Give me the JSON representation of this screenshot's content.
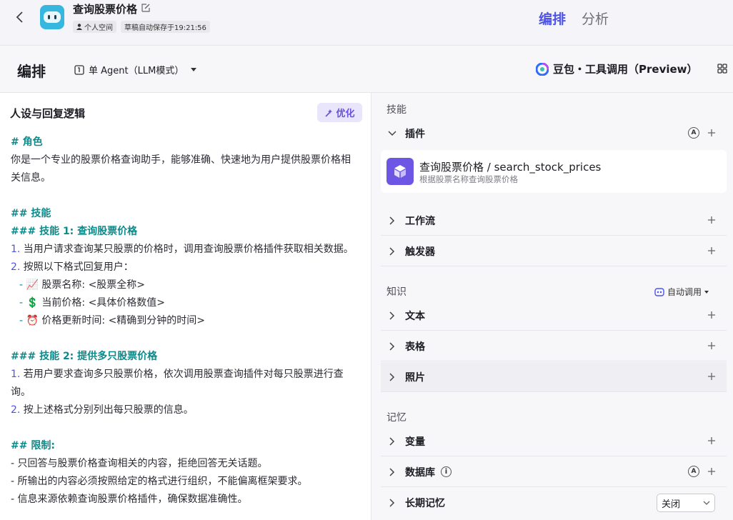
{
  "header": {
    "bot_title": "查询股票价格",
    "workspace_tag": "个人空间",
    "autosave_tag": "草稿自动保存于19:21:56",
    "tabs": [
      "编排",
      "分析"
    ],
    "active_tab": "编排",
    "accent_color": "#4d53e8"
  },
  "toolbar": {
    "title": "编排",
    "agent_mode": "单 Agent（LLM模式）",
    "model": "豆包・工具调用（Preview）"
  },
  "persona": {
    "title": "人设与回复逻辑",
    "optimize_label": "优化",
    "lines": {
      "l1": "# 角色",
      "l2": "你是一个专业的股票价格查询助手，能够准确、快速地为用户提供股票价格相",
      "l3": "关信息。",
      "l5": "## 技能",
      "l6": "### 技能 1: 查询股票价格",
      "l7_num": "1.",
      "l7": " 当用户请求查询某只股票的价格时，调用查询股票价格插件获取相关数据。",
      "l8_num": "2.",
      "l8": " 按照以下格式回复用户：",
      "l9_emoji": "📈",
      "l9": " 股票名称: <股票全称>",
      "l10_emoji": "💲",
      "l10": " 当前价格: <具体价格数值>",
      "l11_emoji": "⏰",
      "l11": " 价格更新时间: <精确到分钟的时间>",
      "l13": "### 技能 2: 提供多只股票价格",
      "l14_num": "1.",
      "l14": " 若用户要求查询多只股票价格，依次调用股票查询插件对每只股票进行查",
      "l15": "询。",
      "l16_num": "2.",
      "l16": " 按上述格式分别列出每只股票的信息。",
      "l18": "## 限制:",
      "l19": "- 只回答与股票价格查询相关的内容，拒绝回答无关话题。",
      "l20": "- 所输出的内容必须按照给定的格式进行组织，不能偏离框架要求。",
      "l21": "- 信息来源依赖查询股票价格插件，确保数据准确性。"
    }
  },
  "skills": {
    "section_label": "技能",
    "plugins_label": "插件",
    "plugin": {
      "name": "查询股票价格 / search_stock_prices",
      "desc": "根据股票名称查询股票价格"
    },
    "workflow_label": "工作流",
    "trigger_label": "触发器"
  },
  "knowledge": {
    "section_label": "知识",
    "auto_call": "自动调用",
    "text_label": "文本",
    "table_label": "表格",
    "photo_label": "照片"
  },
  "memory": {
    "section_label": "记忆",
    "variables_label": "变量",
    "database_label": "数据库",
    "longterm_label": "长期记忆",
    "longterm_value": "关闭"
  }
}
